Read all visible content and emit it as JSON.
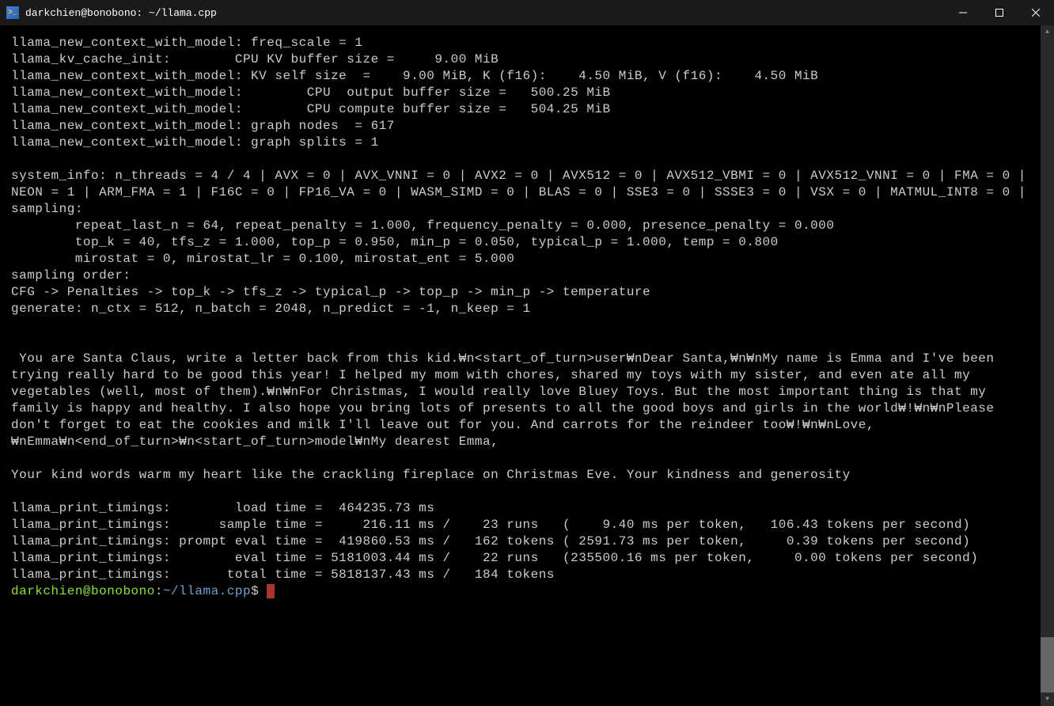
{
  "titlebar": {
    "icon_glyph": ">_",
    "title": "darkchien@bonobono: ~/llama.cpp"
  },
  "terminal": {
    "lines": [
      "llama_new_context_with_model: freq_scale = 1",
      "llama_kv_cache_init:        CPU KV buffer size =     9.00 MiB",
      "llama_new_context_with_model: KV self size  =    9.00 MiB, K (f16):    4.50 MiB, V (f16):    4.50 MiB",
      "llama_new_context_with_model:        CPU  output buffer size =   500.25 MiB",
      "llama_new_context_with_model:        CPU compute buffer size =   504.25 MiB",
      "llama_new_context_with_model: graph nodes  = 617",
      "llama_new_context_with_model: graph splits = 1",
      "",
      "system_info: n_threads = 4 / 4 | AVX = 0 | AVX_VNNI = 0 | AVX2 = 0 | AVX512 = 0 | AVX512_VBMI = 0 | AVX512_VNNI = 0 | FMA = 0 | NEON = 1 | ARM_FMA = 1 | F16C = 0 | FP16_VA = 0 | WASM_SIMD = 0 | BLAS = 0 | SSE3 = 0 | SSSE3 = 0 | VSX = 0 | MATMUL_INT8 = 0 |",
      "sampling:",
      "        repeat_last_n = 64, repeat_penalty = 1.000, frequency_penalty = 0.000, presence_penalty = 0.000",
      "        top_k = 40, tfs_z = 1.000, top_p = 0.950, min_p = 0.050, typical_p = 1.000, temp = 0.800",
      "        mirostat = 0, mirostat_lr = 0.100, mirostat_ent = 5.000",
      "sampling order:",
      "CFG -> Penalties -> top_k -> tfs_z -> typical_p -> top_p -> min_p -> temperature",
      "generate: n_ctx = 512, n_batch = 2048, n_predict = -1, n_keep = 1",
      "",
      "",
      " You are Santa Claus, write a letter back from this kid.₩n<start_of_turn>user₩nDear Santa,₩n₩nMy name is Emma and I've been trying really hard to be good this year! I helped my mom with chores, shared my toys with my sister, and even ate all my vegetables (well, most of them).₩n₩nFor Christmas, I would really love Bluey Toys. But the most important thing is that my family is happy and healthy. I also hope you bring lots of presents to all the good boys and girls in the world₩!₩n₩nPlease don't forget to eat the cookies and milk I'll leave out for you. And carrots for the reindeer too₩!₩n₩nLove,₩nEmma₩n<end_of_turn>₩n<start_of_turn>model₩nMy dearest Emma,",
      "",
      "Your kind words warm my heart like the crackling fireplace on Christmas Eve. Your kindness and generosity",
      "",
      "llama_print_timings:        load time =  464235.73 ms",
      "llama_print_timings:      sample time =     216.11 ms /    23 runs   (    9.40 ms per token,   106.43 tokens per second)",
      "llama_print_timings: prompt eval time =  419860.53 ms /   162 tokens ( 2591.73 ms per token,     0.39 tokens per second)",
      "llama_print_timings:        eval time = 5181003.44 ms /    22 runs   (235500.16 ms per token,     0.00 tokens per second)",
      "llama_print_timings:       total time = 5818137.43 ms /   184 tokens"
    ],
    "prompt": {
      "user": "darkchien",
      "at": "@",
      "host": "bonobono",
      "colon": ":",
      "path": "~/llama.cpp",
      "dollar": "$ "
    }
  }
}
